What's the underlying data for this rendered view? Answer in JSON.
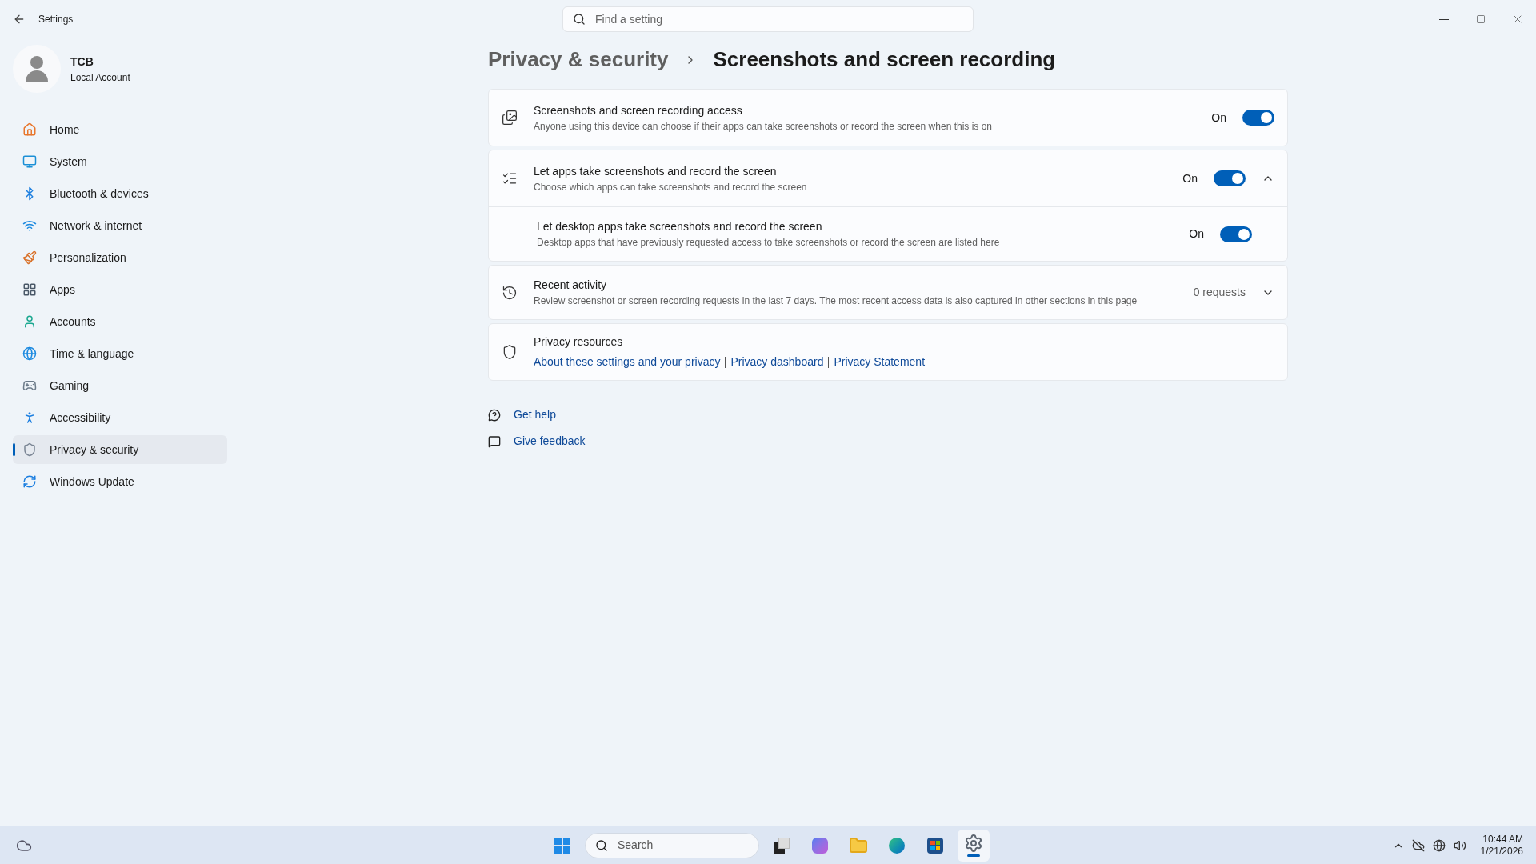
{
  "window": {
    "title": "Settings"
  },
  "search": {
    "placeholder": "Find a setting"
  },
  "account": {
    "name": "TCB",
    "type": "Local Account"
  },
  "sidebar": {
    "items": [
      {
        "label": "Home",
        "selected": false
      },
      {
        "label": "System",
        "selected": false
      },
      {
        "label": "Bluetooth & devices",
        "selected": false
      },
      {
        "label": "Network & internet",
        "selected": false
      },
      {
        "label": "Personalization",
        "selected": false
      },
      {
        "label": "Apps",
        "selected": false
      },
      {
        "label": "Accounts",
        "selected": false
      },
      {
        "label": "Time & language",
        "selected": false
      },
      {
        "label": "Gaming",
        "selected": false
      },
      {
        "label": "Accessibility",
        "selected": false
      },
      {
        "label": "Privacy & security",
        "selected": true
      },
      {
        "label": "Windows Update",
        "selected": false
      }
    ]
  },
  "breadcrumb": [
    "Privacy & security",
    "Screenshots and screen recording"
  ],
  "settings": [
    {
      "kind": "toggle",
      "title": "Screenshots and screen recording access",
      "description": "Anyone using this device can choose if their apps can take screenshots or record the screen when this is on",
      "state": "On",
      "on": true
    },
    {
      "kind": "expander",
      "title": "Let apps take screenshots and record the screen",
      "description": "Choose which apps can take screenshots and record the screen",
      "state": "On",
      "on": true,
      "expanded": true,
      "children": [
        {
          "title": "Let desktop apps take screenshots and record the screen",
          "description": "Desktop apps that have previously requested access to take screenshots or record the screen are listed here",
          "state": "On",
          "on": true
        }
      ]
    },
    {
      "kind": "dropdown",
      "title": "Recent activity",
      "description": "Review screenshot or screen recording requests in the last 7 days. The most recent access data is also captured in other sections in this page",
      "value": "0 requests",
      "expanded": false
    },
    {
      "kind": "links",
      "title": "Privacy resources",
      "links": [
        "About these settings and your privacy",
        "Privacy dashboard",
        "Privacy Statement"
      ]
    }
  ],
  "help_links": [
    "Get help",
    "Give feedback"
  ],
  "taskbar": {
    "search_placeholder": "Search",
    "apps": [
      {
        "selected": false
      },
      {
        "selected": false
      },
      {
        "selected": false
      },
      {
        "selected": false
      },
      {
        "selected": false
      },
      {
        "selected": true
      }
    ],
    "time": "10:44 AM",
    "date": "1/21/2026"
  }
}
